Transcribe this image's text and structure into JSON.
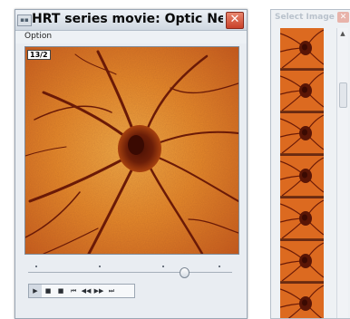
{
  "main_window": {
    "title": "HRT series movie:  Optic Nerve...",
    "close_glyph": "✕",
    "menu_option": "Option",
    "frame_label": "13/2",
    "slider_position_fraction": 0.78
  },
  "transport": {
    "buttons": [
      {
        "name": "play",
        "glyph": "▶"
      },
      {
        "name": "pause",
        "glyph": "■"
      },
      {
        "name": "stop",
        "glyph": "■"
      },
      {
        "name": "first",
        "glyph": "⏮"
      },
      {
        "name": "rewind",
        "glyph": "◀◀"
      },
      {
        "name": "forward",
        "glyph": "▶▶"
      },
      {
        "name": "last",
        "glyph": "⏭"
      }
    ]
  },
  "side_window": {
    "title": "Select Image",
    "close_glyph": "✕",
    "thumbnail_count": 7
  },
  "colors": {
    "fundus_bright": "#f6a83a",
    "fundus_mid": "#d9661b",
    "fundus_dark": "#5a1606",
    "vessel": "#6a1a07",
    "close_red": "#c9412a"
  }
}
